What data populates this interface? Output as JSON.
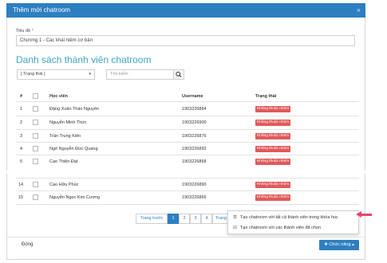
{
  "modal": {
    "title": "Thêm mới chatroom",
    "close_glyph": "×"
  },
  "form": {
    "title_label": "Tiêu đề",
    "required_mark": "*",
    "title_value": "Chương 1 - Các khái niệm cơ bản"
  },
  "section": {
    "title": "Danh sách thành viên chatroom"
  },
  "filters": {
    "status_value": "[ Trạng thái ]",
    "status_caret": "▾",
    "search_placeholder": "Tìm kiếm"
  },
  "table": {
    "headers": {
      "num": "#",
      "student": "Học viên",
      "username": "Username",
      "status": "Trạng thái"
    },
    "rows": [
      {
        "num": "1",
        "name": "Đặng Xuân Thảo Nguyên",
        "username": "1903226884",
        "status": "Không thuộc nhóm"
      },
      {
        "num": "2",
        "name": "Nguyễn Minh Thức",
        "username": "1903226900",
        "status": "Không thuộc nhóm"
      },
      {
        "num": "3",
        "name": "Trần Trung Kiên",
        "username": "1903226876",
        "status": "Không thuộc nhóm"
      },
      {
        "num": "4",
        "name": "Ngô Nguyễn Đức Quang",
        "username": "1903226892",
        "status": "Không thuộc nhóm"
      },
      {
        "num": "5",
        "name": "Cao Thiện Đạt",
        "username": "1903226868",
        "status": "Không thuộc nhóm"
      },
      {
        "num": "14",
        "name": "Cao Hữu Phúc",
        "username": "1903226890",
        "status": "Không thuộc nhóm"
      },
      {
        "num": "15",
        "name": "Nguyễn Ngọc Kim Cương",
        "username": "1903226866",
        "status": "Không thuộc nhóm"
      }
    ]
  },
  "pagination": {
    "prev": "Trang trước",
    "pages": [
      "1",
      "2",
      "3",
      "4"
    ],
    "next_partial": "Trang",
    "active_page": "1"
  },
  "dropdown": {
    "item1": "Tạo chatroom với tất cả thành viên trong khóa học",
    "item2": "Tạo chatroom với các thành viên đã chọn"
  },
  "footer": {
    "close_label": "Đóng",
    "functions_label": "Chức năng"
  },
  "colors": {
    "primary": "#2d7fc1",
    "section_title": "#3fa7c4",
    "badge": "#e05a5a",
    "annotation_arrow": "#e8456b"
  }
}
